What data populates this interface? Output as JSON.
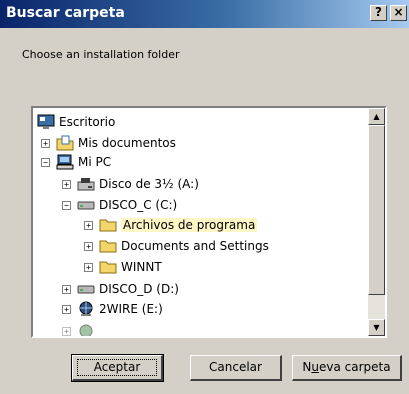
{
  "dialog": {
    "title": "Buscar carpeta",
    "help_glyph": "?",
    "close_glyph": "×",
    "prompt": "Choose an installation folder"
  },
  "tree": {
    "items": [
      {
        "label": "Escritorio",
        "icon": "desktop-icon",
        "expander": ""
      },
      {
        "label": "Mis documentos",
        "icon": "my-documents-icon",
        "expander": "+"
      },
      {
        "label": "Mi PC",
        "icon": "my-computer-icon",
        "expander": "−"
      },
      {
        "label": "Disco de 3½ (A:)",
        "icon": "floppy-drive-icon",
        "expander": "+"
      },
      {
        "label": "DISCO_C (C:)",
        "icon": "hard-drive-icon",
        "expander": "−"
      },
      {
        "label": "Archivos de programa",
        "icon": "folder-icon",
        "expander": "+",
        "selected": true
      },
      {
        "label": "Documents and Settings",
        "icon": "folder-icon",
        "expander": "+"
      },
      {
        "label": "WINNT",
        "icon": "folder-icon",
        "expander": "+"
      },
      {
        "label": "DISCO_D (D:)",
        "icon": "hard-drive-icon",
        "expander": "+"
      },
      {
        "label": "2WIRE (E:)",
        "icon": "network-drive-icon",
        "expander": "+"
      }
    ]
  },
  "buttons": {
    "ok": "Aceptar",
    "cancel": "Cancelar",
    "new_folder_prefix": "N",
    "new_folder_mnemonic": "u",
    "new_folder_suffix": "eva carpeta"
  },
  "colors": {
    "title_bar": "#0a246a",
    "face": "#d4d0c8",
    "selection": "#fff6c6",
    "folder": "#f2d56b"
  }
}
